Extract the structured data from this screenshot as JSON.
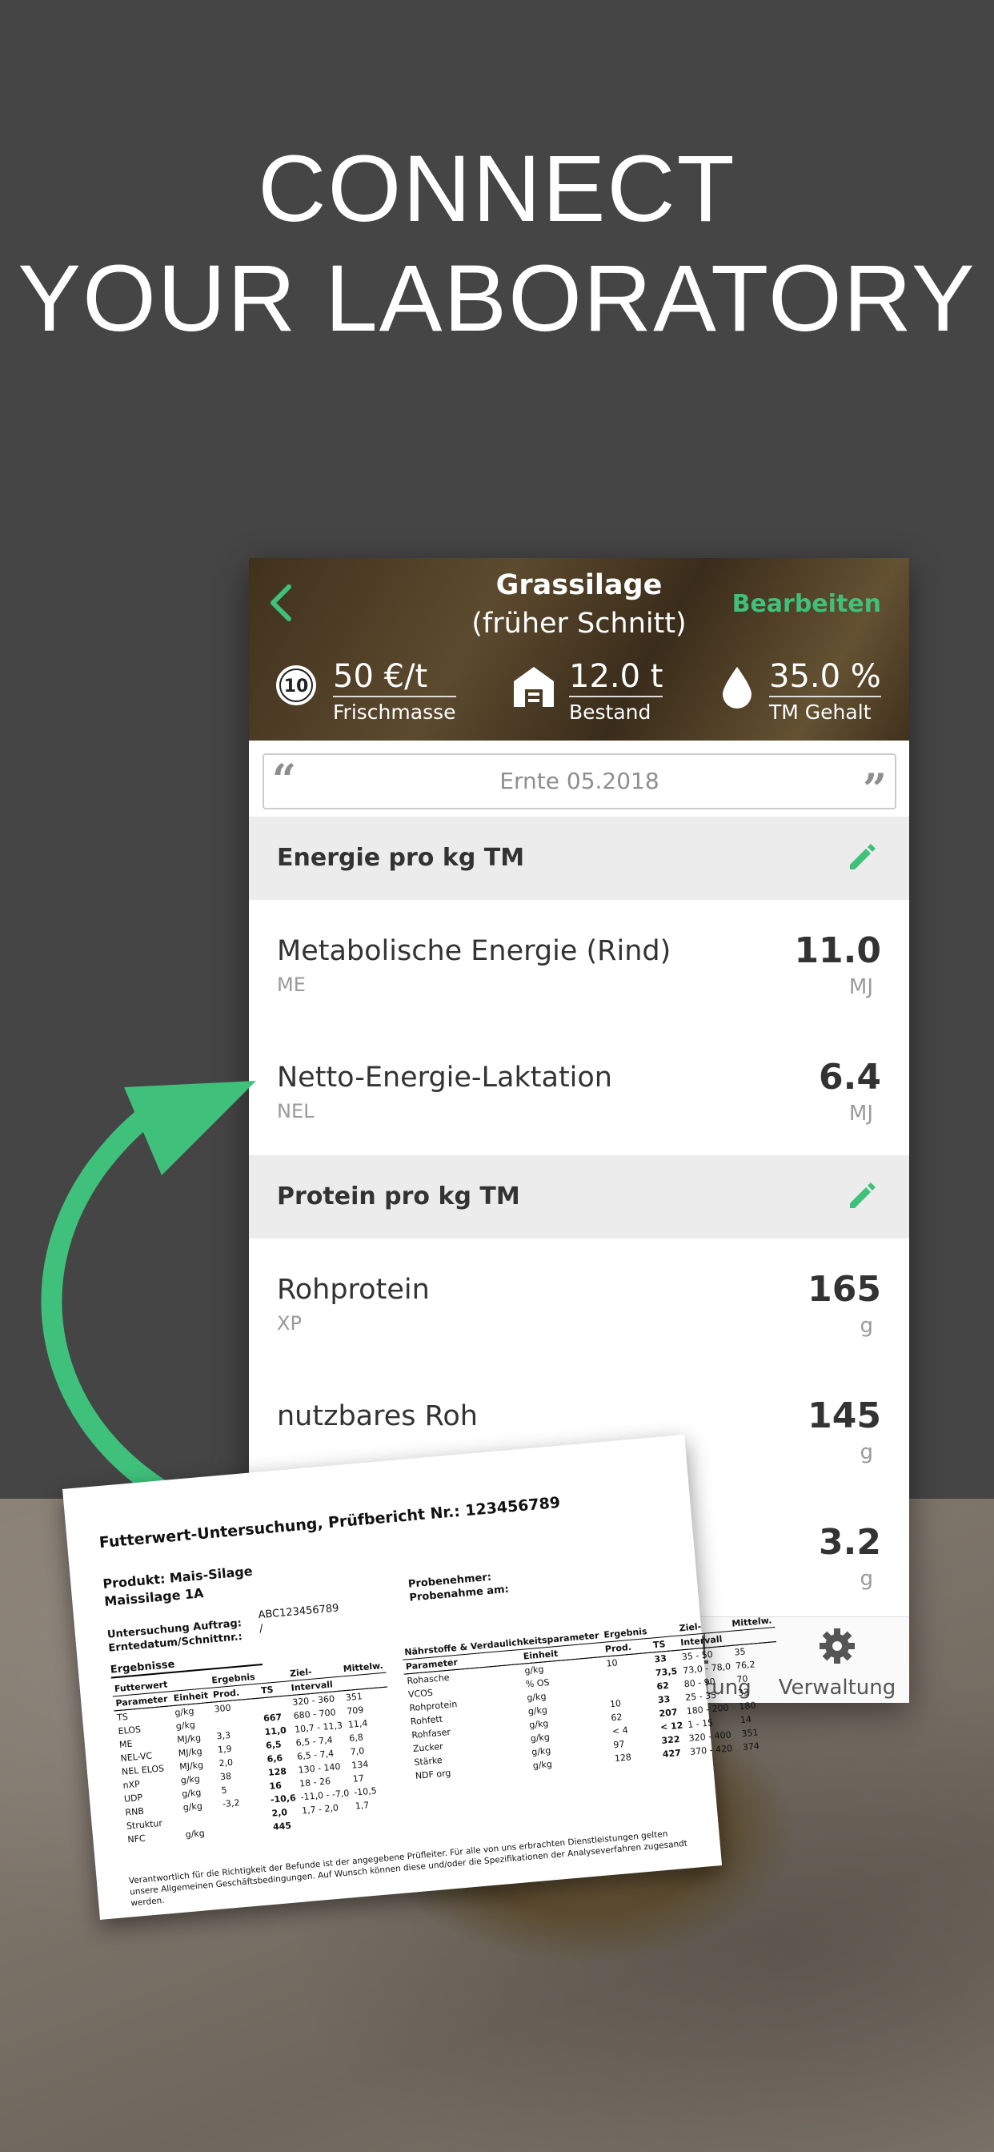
{
  "headline": {
    "line1": "CONNECT",
    "line2": "YOUR LABORATORY"
  },
  "app": {
    "back_icon": "chevron-left-icon",
    "title_line1": "Grassilage",
    "title_line2": "(früher Schnitt)",
    "edit_label": "Bearbeiten",
    "accent": "#3fc17b",
    "stats": [
      {
        "icon": "coin-icon",
        "value": "50 €/t",
        "label": "Frischmasse"
      },
      {
        "icon": "barn-icon",
        "value": "12.0 t",
        "label": "Bestand"
      },
      {
        "icon": "drop-icon",
        "value": "35.0 %",
        "label": "TM Gehalt"
      }
    ],
    "note": "Ernte 05.2018",
    "sections": [
      {
        "title": "Energie pro kg TM",
        "rows": [
          {
            "name": "Metabolische Energie (Rind)",
            "abbr": "ME",
            "value": "11.0",
            "unit": "MJ"
          },
          {
            "name": "Netto-Energie-Laktation",
            "abbr": "NEL",
            "value": "6.4",
            "unit": "MJ"
          }
        ]
      },
      {
        "title": "Protein pro kg TM",
        "rows": [
          {
            "name": "Rohprotein",
            "abbr": "XP",
            "value": "165",
            "unit": "g"
          },
          {
            "name": "nutzbares Roh",
            "abbr": "",
            "value": "145",
            "unit": "g"
          },
          {
            "name": "",
            "abbr": "",
            "value": "3.2",
            "unit": "g"
          }
        ]
      }
    ],
    "tabs": [
      {
        "icon": "chart-icon",
        "label": "Auswertung"
      },
      {
        "icon": "gear-icon",
        "label": "Verwaltung"
      }
    ]
  },
  "report": {
    "title": "Futterwert-Untersuchung, Prüfbericht Nr.: 123456789",
    "product": "Produkt: Mais-Silage",
    "product_name": "Maissilage 1A",
    "order_label": "Untersuchung Auftrag:",
    "date_label": "Erntedatum/Schnittnr.:",
    "order_value": "ABC123456789",
    "date_value": "/",
    "sampler_label": "Probenehmer:",
    "sample_date_label": "Probenahme am:",
    "results_label": "Ergebnisse",
    "left_table": {
      "group": [
        "Futterwert",
        "",
        "Ergebnis",
        "",
        "Ziel-",
        "Mittelw."
      ],
      "header": [
        "Parameter",
        "Einheit",
        "Prod.",
        "TS",
        "Intervall",
        ""
      ],
      "rows": [
        [
          "TS",
          "g/kg",
          "300",
          "",
          "320 - 360",
          "351"
        ],
        [
          "ELOS",
          "g/kg",
          "",
          "667",
          "680 - 700",
          "709"
        ],
        [
          "ME",
          "MJ/kg",
          "3,3",
          "11,0",
          "10,7 - 11,3",
          "11,4"
        ],
        [
          "NEL-VC",
          "MJ/kg",
          "1,9",
          "6,5",
          "6,5 - 7,4",
          "6,8"
        ],
        [
          "NEL ELOS",
          "MJ/kg",
          "2,0",
          "6,6",
          "6,5 - 7,4",
          "7,0"
        ],
        [
          "nXP",
          "g/kg",
          "38",
          "128",
          "130 - 140",
          "134"
        ],
        [
          "UDP",
          "g/kg",
          "5",
          "16",
          "18 - 26",
          "17"
        ],
        [
          "RNB",
          "g/kg",
          "-3,2",
          "-10,6",
          "-11,0 - -7,0",
          "-10,5"
        ],
        [
          "Struktur",
          "",
          "",
          "2,0",
          "1,7 - 2,0",
          "1,7"
        ],
        [
          "NFC",
          "g/kg",
          "",
          "445",
          "",
          ""
        ]
      ]
    },
    "right_table": {
      "group": [
        "Nährstoffe & Verdaulichkeitsparameter",
        "",
        "Ergebnis",
        "",
        "Ziel-",
        "Mittelw."
      ],
      "header": [
        "Parameter",
        "Einheit",
        "Prod.",
        "TS",
        "Intervall",
        ""
      ],
      "rows": [
        [
          "Rohasche",
          "g/kg",
          "10",
          "33",
          "35 - 50",
          "35"
        ],
        [
          "VCOS",
          "% OS",
          "",
          "73,5",
          "73,0 - 78,0",
          "76,2"
        ],
        [
          "Rohprotein",
          "g/kg",
          "",
          "62",
          "80 - 90",
          "70"
        ],
        [
          "Rohfett",
          "g/kg",
          "10",
          "33",
          "25 - 35",
          "33"
        ],
        [
          "Rohfaser",
          "g/kg",
          "62",
          "207",
          "180 - 200",
          "180"
        ],
        [
          "Zucker",
          "g/kg",
          "< 4",
          "< 12",
          "1 - 15",
          "14"
        ],
        [
          "Stärke",
          "g/kg",
          "97",
          "322",
          "320 - 400",
          "351"
        ],
        [
          "NDF org",
          "g/kg",
          "128",
          "427",
          "370 - 420",
          "374"
        ]
      ]
    },
    "footer": "Verantwortlich für die Richtigkeit der Befunde ist der angegebene Prüfleiter. Für alle von uns erbrachten Dienstleistungen gelten unsere Allgemeinen Geschäftsbedingungen. Auf Wunsch können diese und/oder die Spezifikationen der Analyseverfahren zugesandt werden."
  }
}
